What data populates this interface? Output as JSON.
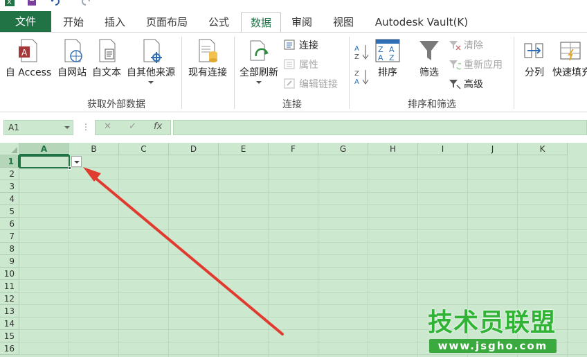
{
  "quick_access": {
    "icons": [
      "excel-logo-icon",
      "save-icon",
      "undo-icon",
      "redo-icon"
    ]
  },
  "tabs": [
    {
      "label": "文件"
    },
    {
      "label": "开始"
    },
    {
      "label": "插入"
    },
    {
      "label": "页面布局"
    },
    {
      "label": "公式"
    },
    {
      "label": "数据"
    },
    {
      "label": "审阅"
    },
    {
      "label": "视图"
    },
    {
      "label": "Autodesk Vault(K)"
    }
  ],
  "active_tab": "数据",
  "ribbon": {
    "get_external": {
      "group_label": "获取外部数据",
      "access": "自 Access",
      "web": "自网站",
      "text": "自文本",
      "other": "自其他来源"
    },
    "existing": "现有连接",
    "connections": {
      "group_label": "连接",
      "refresh_all": "全部刷新",
      "connections": "连接",
      "properties": "属性",
      "edit_links": "编辑链接"
    },
    "sort_filter": {
      "group_label": "排序和筛选",
      "sort": "排序",
      "filter": "筛选",
      "clear": "清除",
      "reapply": "重新应用",
      "advanced": "高级"
    },
    "text_to_columns": "分列",
    "flash_fill": "快速填充"
  },
  "formula_bar": {
    "name_box": "A1",
    "dots": "⋮",
    "cancel": "✕",
    "enter": "✓",
    "fx": "fx",
    "value": ""
  },
  "sheet": {
    "columns": [
      "A",
      "B",
      "C",
      "D",
      "E",
      "F",
      "G",
      "H",
      "I",
      "J",
      "K"
    ],
    "rows": [
      "1",
      "2",
      "3",
      "4",
      "5",
      "6",
      "7",
      "8",
      "9",
      "10",
      "11",
      "12",
      "13",
      "14",
      "15",
      "16"
    ],
    "selected_cell": "A1"
  },
  "colors": {
    "excel_green": "#217346",
    "sheet_bg": "#cce8cf",
    "annotation_arrow": "#e03b2e"
  },
  "watermark": {
    "title": "技术员联盟",
    "url": "www.jsgho.com"
  }
}
